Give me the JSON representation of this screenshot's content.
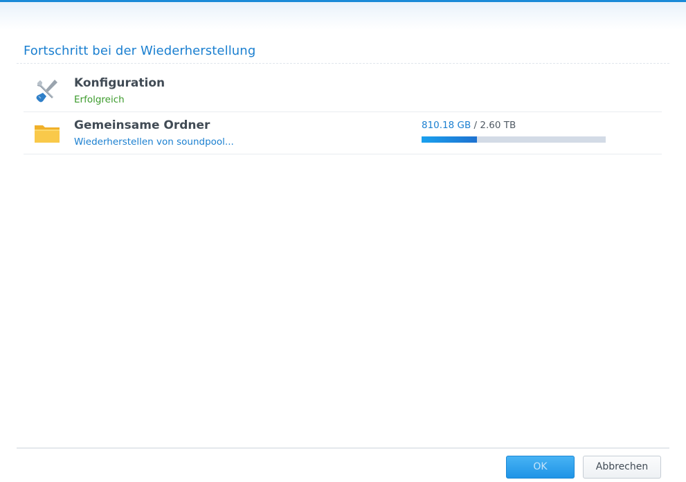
{
  "dialog": {
    "title": "Fortschritt bei der Wiederherstellung",
    "accent_color": "#1a7fd0"
  },
  "tasks": [
    {
      "icon": "tools-icon",
      "name": "Konfiguration",
      "status": "Erfolgreich",
      "status_color": "#3a9a2a"
    },
    {
      "icon": "folder-icon",
      "name": "Gemeinsame Ordner",
      "status": "Wiederherstellen von soundpool...",
      "status_color": "#1a7fd0",
      "progress": {
        "done": "810.18 GB",
        "separator": " / ",
        "total": "2.60 TB",
        "fraction": 0.3
      }
    }
  ],
  "buttons": {
    "ok_label": "OK",
    "cancel_label": "Abbrechen"
  }
}
